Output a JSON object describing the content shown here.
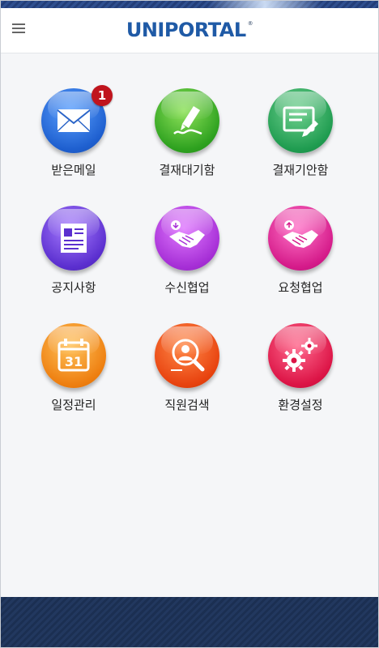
{
  "header": {
    "logo_text": "UNIPORTAL",
    "logo_mark": "®",
    "menu_icon": "hamburger-menu-icon"
  },
  "colors": {
    "brand": "#1f5aa6",
    "badge": "#c0141d",
    "footer": "#22385f"
  },
  "menu": [
    {
      "label": "받은메일",
      "icon": "envelope-icon",
      "badge": "1"
    },
    {
      "label": "결재대기함",
      "icon": "pen-sign-icon"
    },
    {
      "label": "결재기안함",
      "icon": "document-pen-icon"
    },
    {
      "label": "공지사항",
      "icon": "newspaper-icon"
    },
    {
      "label": "수신협업",
      "icon": "handshake-down-icon"
    },
    {
      "label": "요청협업",
      "icon": "handshake-up-icon"
    },
    {
      "label": "일정관리",
      "icon": "calendar-icon",
      "calendar_day": "31"
    },
    {
      "label": "직원검색",
      "icon": "person-search-icon"
    },
    {
      "label": "환경설정",
      "icon": "gears-icon"
    }
  ]
}
